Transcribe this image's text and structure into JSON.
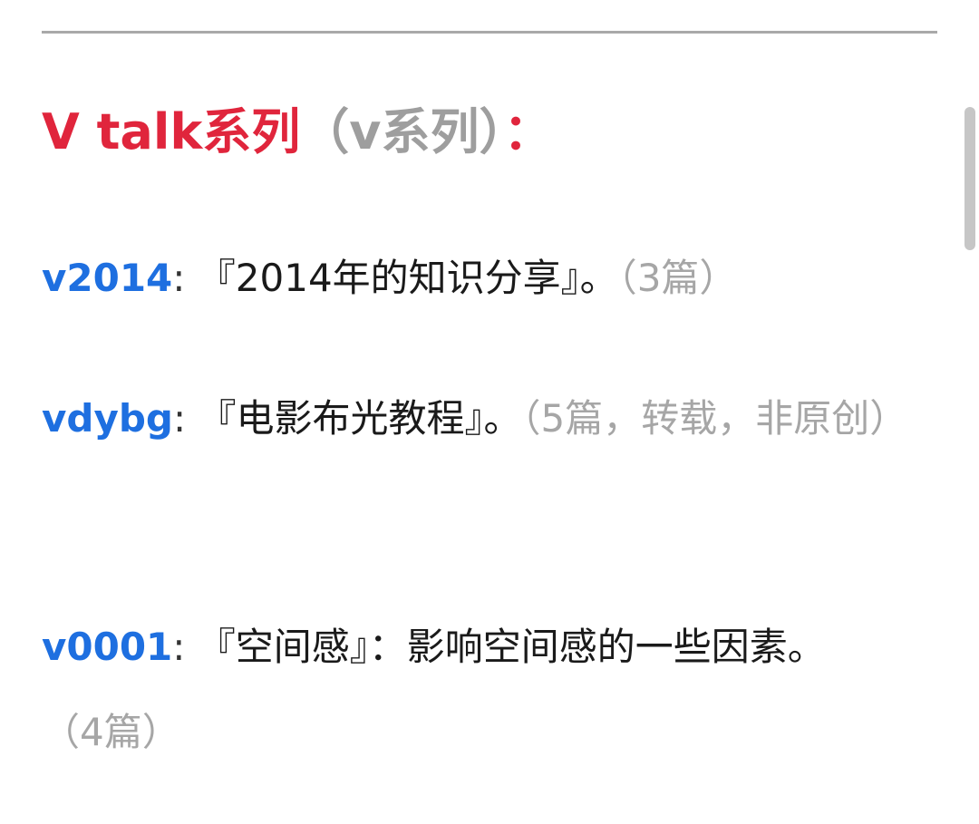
{
  "section": {
    "title_main": "V talk系列",
    "title_paren": "（v系列）",
    "title_colon": "："
  },
  "entries": [
    {
      "code": "v2014",
      "separator": ":",
      "title": "『2014年的知识分享』。",
      "note": "（3篇）"
    },
    {
      "code": "vdybg",
      "separator": ":",
      "title": "『电影布光教程』。",
      "note": "（5篇，转载，非原创）"
    },
    {
      "code": "v0001",
      "separator": ":",
      "title": "『空间感』：影响空间感的一些因素。",
      "note": "（4篇）"
    }
  ],
  "colors": {
    "heading_red": "#e0253c",
    "link_blue": "#1e6fe0",
    "note_gray": "#a6a6a6",
    "divider_gray": "#a9a9a9"
  }
}
